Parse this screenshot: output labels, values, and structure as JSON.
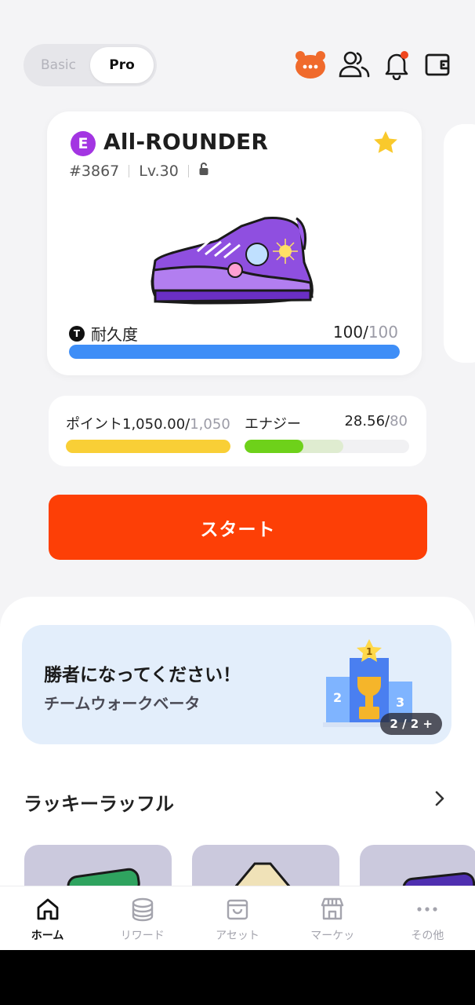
{
  "header": {
    "mode_basic": "Basic",
    "mode_pro": "Pro",
    "icons": [
      "chat-bubble-icon",
      "friends-icon",
      "bell-icon",
      "wallet-icon"
    ]
  },
  "card": {
    "rarity": "E",
    "name": "All-ROUNDER",
    "id": "#3867",
    "level": "Lv.30",
    "durability_label": "耐久度",
    "durability_value": "100",
    "durability_max": "100",
    "durability_fraction": 1.0
  },
  "stats": {
    "points_label": "ポイント",
    "points_value": "1,050.00",
    "points_max": "1,050",
    "points_fraction": 1.0,
    "energy_label": "エナジー",
    "energy_value": "28.56",
    "energy_max": "80",
    "energy_fraction": 0.357
  },
  "start_button": "スタート",
  "banner": {
    "title": "勝者になってください！",
    "subtitle": "チームウォークベータ",
    "pager": "2 / 2 +"
  },
  "raffle": {
    "title": "ラッキーラッフル"
  },
  "nav": {
    "items": [
      {
        "label": "ホーム",
        "icon": "home-icon",
        "active": true
      },
      {
        "label": "リワード",
        "icon": "coins-icon",
        "active": false
      },
      {
        "label": "アセット",
        "icon": "bag-icon",
        "active": false
      },
      {
        "label": "マーケッ",
        "icon": "store-icon",
        "active": false
      },
      {
        "label": "その他",
        "icon": "more-icon",
        "active": false
      }
    ]
  },
  "colors": {
    "accent": "#fd3f06",
    "rarity_purple": "#a335e2",
    "durability_blue": "#3e8ef7",
    "points_yellow": "#f9cf36",
    "energy_green": "#6ed11a"
  }
}
